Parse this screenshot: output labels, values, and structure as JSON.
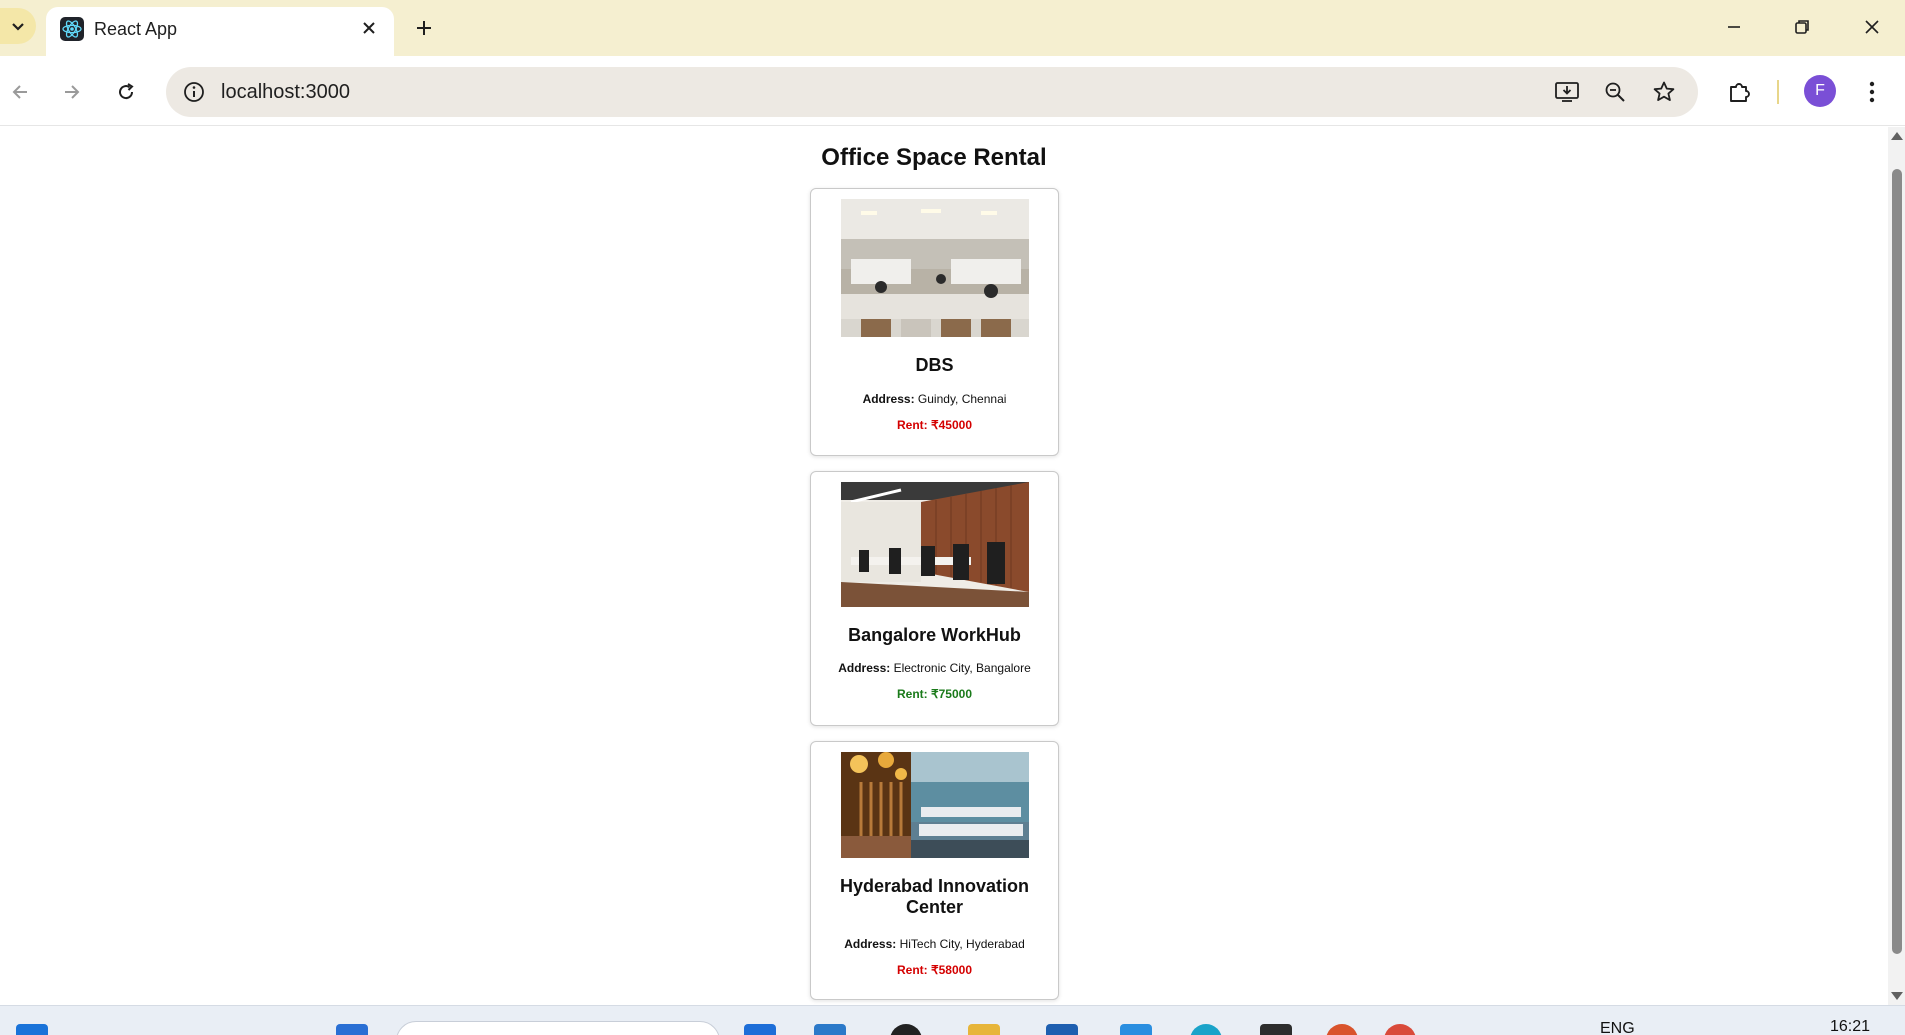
{
  "browser": {
    "tab_title": "React App",
    "url": "localhost:3000",
    "profile_initial": "F"
  },
  "page": {
    "title": "Office Space Rental",
    "address_label": "Address:",
    "rent_label": "Rent:",
    "colors": {
      "rent_low": "#d40000",
      "rent_high": "#1a7a1a"
    },
    "offices": [
      {
        "name": "DBS",
        "address": "Guindy, Chennai",
        "rent": "₹45000",
        "rent_color": "#d40000",
        "image": "office-photo-open-floor"
      },
      {
        "name": "Bangalore WorkHub",
        "address": "Electronic City, Bangalore",
        "rent": "₹75000",
        "rent_color": "#1a7a1a",
        "image": "office-photo-wood-wall"
      },
      {
        "name": "Hyderabad Innovation Center",
        "address": "HiTech City, Hyderabad",
        "rent": "₹58000",
        "rent_color": "#d40000",
        "image": "office-photo-lounge"
      }
    ]
  },
  "taskbar": {
    "language": "ENG",
    "time": "16:21"
  }
}
